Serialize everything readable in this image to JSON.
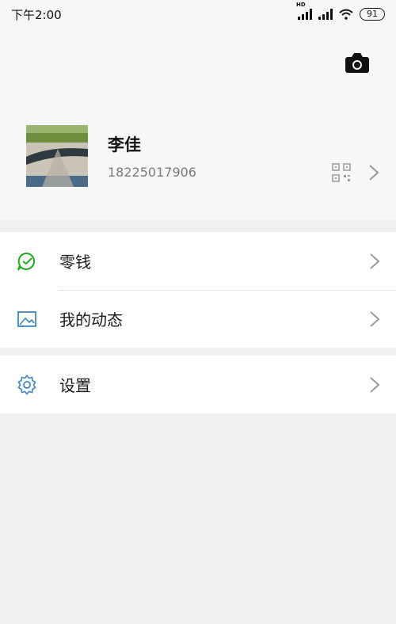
{
  "status_bar": {
    "time": "下午2:00",
    "network_label": "HD",
    "battery": "91"
  },
  "profile": {
    "name": "李佳",
    "phone": "18225017906"
  },
  "menu": [
    {
      "label": "零钱",
      "icon": "wallet-icon",
      "icon_color": "#1aad19"
    },
    {
      "label": "我的动态",
      "icon": "image-icon",
      "icon_color": "#3d84c6"
    },
    {
      "label": "设置",
      "icon": "gear-icon",
      "icon_color": "#3d84c6"
    }
  ],
  "colors": {
    "background": "#f0f0f0",
    "header_bg": "#f7f7f7",
    "row_bg": "#ffffff",
    "accent_green": "#1aad19",
    "accent_blue": "#3d84c6"
  }
}
